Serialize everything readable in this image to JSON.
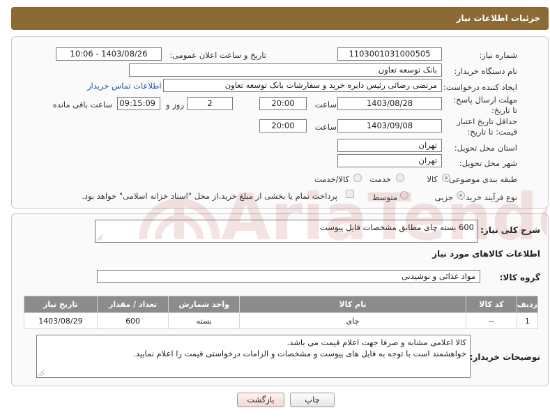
{
  "header": {
    "title": "جزئیات اطلاعات نیاز"
  },
  "form": {
    "need_number_label": "شماره نیاز:",
    "need_number": "1103001031000505",
    "announce_label": "تاریخ و ساعت اعلان عمومی:",
    "announce_value": "1403/08/26 - 10:06",
    "buyer_org_label": "نام دستگاه خریدار:",
    "buyer_org": "بانک توسعه تعاون",
    "creator_label": "ایجاد کننده درخواست:",
    "creator": "مرتضی رضائی رئیس دایره خرید و سفارشات بانک توسعه تعاون",
    "contact_link": "اطلاعات تماس خریدار",
    "reply_deadline_label": "مهلت ارسال پاسخ: تا تاریخ:",
    "reply_date": "1403/08/28",
    "time_label": "ساعت",
    "reply_time": "20:00",
    "days_value": "2",
    "days_label": "روز و",
    "remaining_time": "09:15:09",
    "remaining_label": "ساعت باقی مانده",
    "price_validity_label": "حداقل تاریخ اعتبار قیمت: تا تاریخ:",
    "validity_date": "1403/09/08",
    "validity_time": "20:00",
    "province_label": "استان محل تحویل:",
    "province": "تهران",
    "city_label": "شهر محل تحویل:",
    "city": "تهران",
    "category_label": "طبقه بندی موضوعی:",
    "category_options": [
      "کالا",
      "خدمت",
      "کالا/خدمت"
    ],
    "process_label": "نوع فرآیند خرید :",
    "process_options": [
      "جزیی",
      "متوسط"
    ],
    "payment_note": "پرداخت تمام یا بخشی از مبلغ خرید،از محل \"اسناد خزانه اسلامی\" خواهد بود."
  },
  "details": {
    "general_desc_label": "شرح کلی نیاز:",
    "general_desc": "600 بسته چای مطابق مشخصات فایل پیوست",
    "goods_info_title": "اطلاعات کالاهای مورد نیاز",
    "goods_group_label": "گروه کالا:",
    "goods_group": "مواد غذائی و نوشیدنی",
    "table_headers": [
      "ردیف",
      "کد کالا",
      "نام کالا",
      "واحد شمارش",
      "تعداد / مقدار",
      "تاریخ نیاز"
    ],
    "rows": [
      [
        "1",
        "--",
        "چای",
        "بسته",
        "600",
        "1403/08/29"
      ]
    ],
    "buyer_notes_label": "توضیحات خریدار:",
    "buyer_notes_line1": "کالا اعلامی مشابه و صرفا جهت اعلام قیمت می باشد.",
    "buyer_notes_line2": "خواهشمند است با توجه به فایل های پیوست و مشخصات و الزامات درخواستی قیمت را اعلام نمایید."
  },
  "buttons": {
    "print": "چاپ",
    "back": "بازگشت"
  },
  "watermark": {
    "text": "AriaTender.net",
    "color": "#b03030"
  }
}
